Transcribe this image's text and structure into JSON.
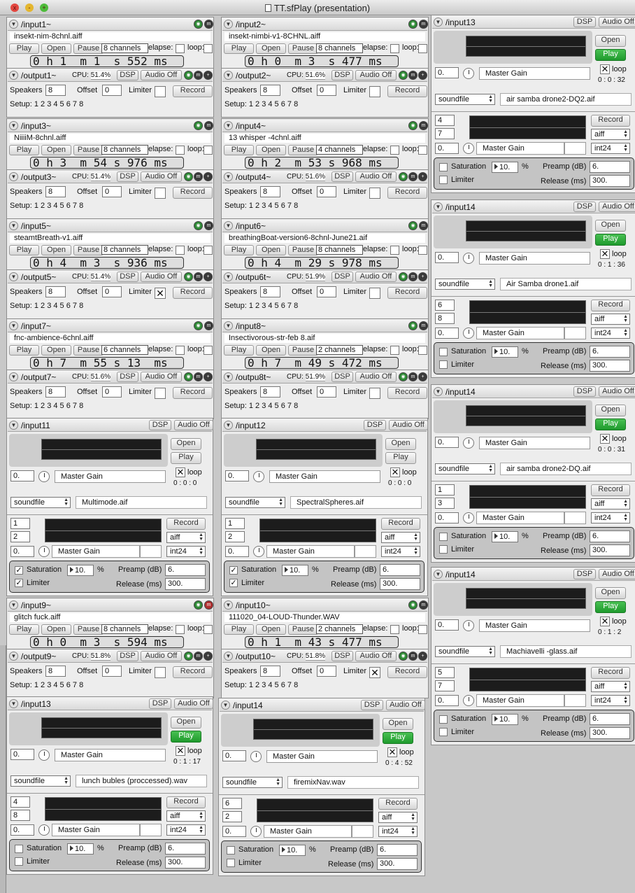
{
  "window": {
    "title": "TT.sfPlay (presentation)",
    "close": "x",
    "minimize": "-",
    "zoom": "+"
  },
  "common": {
    "play": "Play",
    "open": "Open",
    "pause": "Pause",
    "elapse": "elapse:",
    "loop": "loop:",
    "cpu_label": "CPU:",
    "dsp": "DSP",
    "audio_off": "Audio Off",
    "speakers": "Speakers",
    "offset": "Offset",
    "limiter": "Limiter",
    "record": "Record",
    "setup": "Setup: 1 2 3 4 5 6 7 8",
    "loop_word": "loop",
    "master_gain": "Master Gain",
    "soundfile": "soundfile",
    "aiff": "aiff",
    "int24": "int24",
    "saturation": "Saturation",
    "percent": "%",
    "preamp": "Preamp (dB)",
    "release": "Release (ms)",
    "gain_value": "0.",
    "sat_value": "10.",
    "preamp_value": "6.",
    "release_value": "300.",
    "speakers_value": "8",
    "offset_value": "0"
  },
  "inputs": [
    {
      "name": "/input1~",
      "file": "insekt-nim-8chnl.aiff",
      "channels": "8 channels",
      "time": "0 h 1  m 1  s 552 ms",
      "output": "/output1~",
      "cpu": "51.4%",
      "limiter": ""
    },
    {
      "name": "/input2~",
      "file": "insekt-nimbi-v1-8CHNL.aiff",
      "channels": "8 channels",
      "time": "0 h 0  m 3  s 477 ms",
      "output": "/output2~",
      "cpu": "51.6%",
      "limiter": ""
    },
    {
      "name": "/input3~",
      "file": "NiiiiM-8chnl.aiff",
      "channels": "8 channels",
      "time": "0 h 3  m 54 s 976 ms",
      "output": "/output3~",
      "cpu": "51.4%",
      "limiter": ""
    },
    {
      "name": "/input4~",
      "file": "13 whisper -4chnl.aiff",
      "channels": "4 channels",
      "time": "0 h 2  m 53 s 968 ms",
      "output": "/output4~",
      "cpu": "51.6%",
      "limiter": ""
    },
    {
      "name": "/input5~",
      "file": "steamtBreath-v1.aiff",
      "channels": "8 channels",
      "time": "0 h 4  m 3  s 936 ms",
      "output": "/output5~",
      "cpu": "51.4%",
      "limiter": "✕"
    },
    {
      "name": "/input6~",
      "file": "breathingBoat-version6-8chnl-June21.aif",
      "channels": "8 channels",
      "time": "0 h 4  m 29 s 978 ms",
      "output": "/outpu6t~",
      "cpu": "51.9%",
      "limiter": ""
    },
    {
      "name": "/input7~",
      "file": "fnc-ambience-6chnl.aiff",
      "channels": "6 channels",
      "time": "0 h 7  m 55 s 13  ms",
      "output": "/output7~",
      "cpu": "51.6%",
      "limiter": ""
    },
    {
      "name": "/input8~",
      "file": "Insectivorous-str-feb 8.aif",
      "channels": "2 channels",
      "time": "0 h 7  m 49 s 472 ms",
      "output": "/outpu8t~",
      "cpu": "51.9%",
      "limiter": ""
    },
    {
      "name": "/input9~",
      "file": "glitch fuck.aiff",
      "channels": "8 channels",
      "time": "0 h 0  m 3  s 594 ms",
      "output": "/output9~",
      "cpu": "51.8%",
      "limiter": ""
    },
    {
      "name": "/input10~",
      "file": "111020_04-LOUD-Thunder.WAV",
      "channels": "2 channels",
      "time": "0 h 1  m 43 s 477 ms",
      "output": "/output10~",
      "cpu": "51.8%",
      "limiter": "✕"
    }
  ],
  "players": [
    {
      "name": "/input11",
      "loop": "✕",
      "time": "0 : 0 : 0",
      "file": "Multimode.aif",
      "ch1": "1",
      "ch2": "2",
      "sat_checked": "✓",
      "lim_checked": "✓"
    },
    {
      "name": "/input12",
      "loop": "✕",
      "time": "0 : 0 : 0",
      "file": "SpectralSpheres.aif",
      "ch1": "1",
      "ch2": "2",
      "sat_checked": "✓",
      "lim_checked": "✓"
    },
    {
      "name": "/input13",
      "loop": "✕",
      "time": "0 : 1 : 17",
      "file": "lunch bubles (proccessed).wav",
      "ch1": "4",
      "ch2": "8",
      "sat_checked": "",
      "lim_checked": ""
    },
    {
      "name": "/input14",
      "loop": "✕",
      "time": "0 : 4 : 52",
      "file": "firemixNav.wav",
      "ch1": "6",
      "ch2": "2",
      "sat_checked": "",
      "lim_checked": ""
    },
    {
      "name": "/input13",
      "loop": "✕",
      "time": "0 : 0 : 32",
      "file": "air samba drone2-DQ2.aif",
      "ch1": "4",
      "ch2": "7",
      "sat_checked": "",
      "lim_checked": ""
    },
    {
      "name": "/input14",
      "loop": "✕",
      "time": "0 : 1 : 36",
      "file": "Air Samba drone1.aif",
      "ch1": "6",
      "ch2": "8",
      "sat_checked": "",
      "lim_checked": ""
    },
    {
      "name": "/input14",
      "loop": "✕",
      "time": "0 : 0 : 31",
      "file": "air samba drone2-DQ.aif",
      "ch1": "1",
      "ch2": "3",
      "sat_checked": "",
      "lim_checked": ""
    },
    {
      "name": "/input14",
      "loop": "✕",
      "time": "0 : 1 : 2",
      "file": "Machiavelli -glass.aif",
      "ch1": "5",
      "ch2": "7",
      "sat_checked": "",
      "lim_checked": ""
    }
  ]
}
